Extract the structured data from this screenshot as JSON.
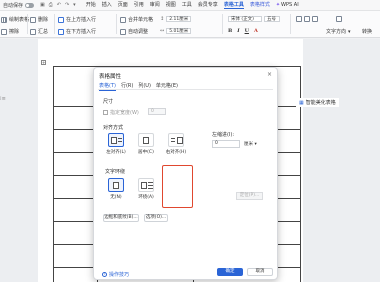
{
  "menubar": {
    "autosave_label": "自动保存",
    "menus": [
      "开始",
      "插入",
      "页面",
      "引用",
      "审阅",
      "视图",
      "工具",
      "会员专享",
      "表格工具",
      "表格样式",
      "WPS AI"
    ],
    "active_menu": "表格工具"
  },
  "ribbon": {
    "draw_table": "绘制表格",
    "eraser": "擦除",
    "delete": "删除",
    "summary": "汇总",
    "insert_above": "在上方插入行",
    "insert_below": "在下方插入行",
    "merge_cells": "合并单元格",
    "split_cells": "拆分单元格",
    "auto_fit": "自动调整",
    "height_value": "2.11厘米",
    "width_value": "5.01厘米",
    "font_name": "宋体 (正文)",
    "font_size": "五号",
    "text_direction": "文字方向",
    "convert": "转换",
    "format_buttons": [
      "B",
      "I",
      "U",
      "A"
    ]
  },
  "doc": {
    "smart_beautify": "智能美化表格",
    "corner_symbol": "+"
  },
  "dialog": {
    "title": "表格属性",
    "close_symbol": "×",
    "tabs": [
      "表格(T)",
      "行(R)",
      "列(U)",
      "单元格(E)"
    ],
    "active_tab": "表格(T)",
    "size_section": "尺寸",
    "preferred_width_label": "指定宽度(W)",
    "preferred_width_value": "0",
    "alignment_section": "对齐方式",
    "align_left": "左对齐(L)",
    "align_center": "居中(C)",
    "align_right": "右对齐(H)",
    "indent_label": "左缩进(I):",
    "indent_value": "0",
    "indent_unit": "厘米",
    "wrap_section": "文字环绕",
    "wrap_none": "无(N)",
    "wrap_around": "环绕(A)",
    "position_button": "定位(P)...",
    "borders_button": "边框和底纹(B)...",
    "options_button": "选项(O)...",
    "tips_link": "操作技巧",
    "ok_button": "确定",
    "cancel_button": "取消"
  },
  "colors": {
    "accent": "#2a64d6",
    "highlight": "#e0482f"
  }
}
